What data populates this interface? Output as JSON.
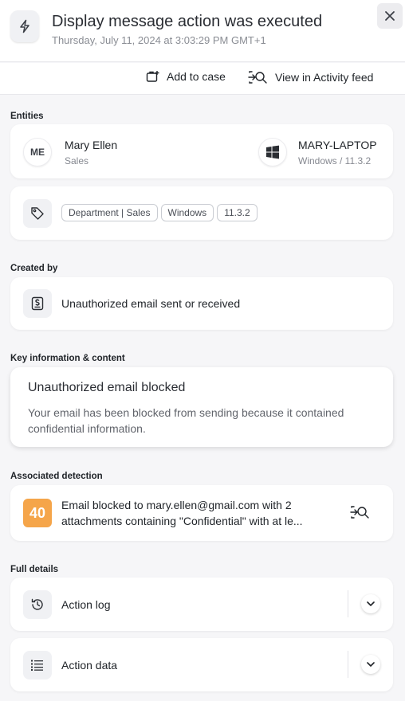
{
  "header": {
    "title": "Display message action was executed",
    "subtitle": "Thursday, July 11, 2024 at 3:03:29 PM GMT+1"
  },
  "actions": {
    "add_to_case": "Add to case",
    "view_activity": "View in Activity feed"
  },
  "entities": {
    "label": "Entities",
    "user": {
      "initials": "ME",
      "name": "Mary Ellen",
      "department": "Sales"
    },
    "device": {
      "name": "MARY-LAPTOP",
      "os": "Windows / 11.3.2"
    },
    "tags": [
      "Department | Sales",
      "Windows",
      "11.3.2"
    ]
  },
  "created_by": {
    "label": "Created by",
    "policy": "Unauthorized email sent or received"
  },
  "key_info": {
    "label": "Key information & content",
    "title": "Unauthorized email blocked",
    "body_line1": "Your email has been blocked from sending because it contained",
    "body_line2": "confidential information."
  },
  "detection": {
    "label": "Associated detection",
    "score": "40",
    "line1": "Email blocked to mary.ellen@gmail.com with 2",
    "line2": "attachments containing \"Confidential\" with at le..."
  },
  "full_details": {
    "label": "Full details",
    "action_log": "Action log",
    "action_data": "Action data"
  },
  "colors": {
    "score_bg": "#f5a54a",
    "background": "#f6f6f8",
    "card": "#ffffff"
  }
}
